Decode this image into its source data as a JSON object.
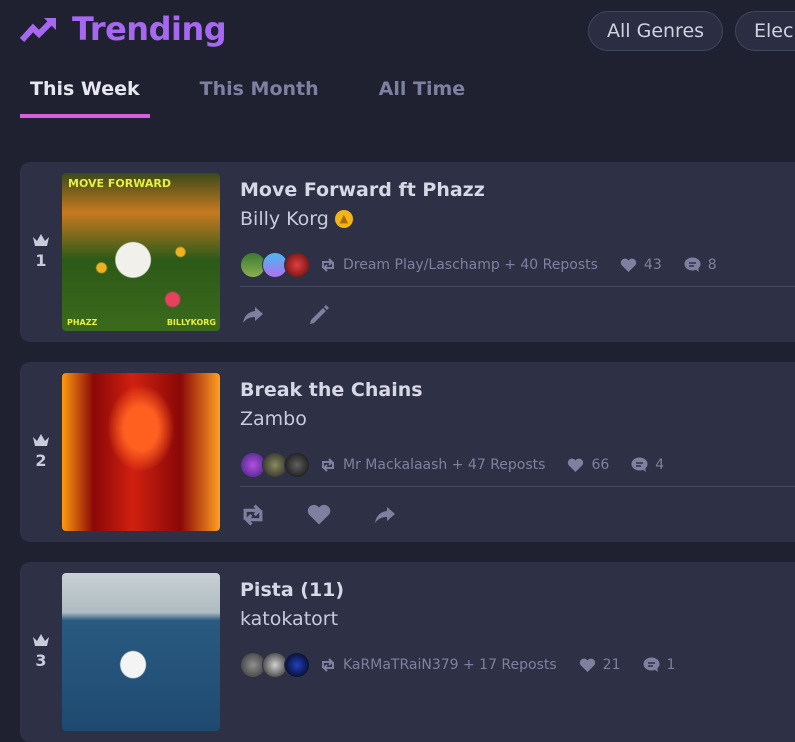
{
  "header": {
    "title": "Trending",
    "icon": "trending-up-icon"
  },
  "genres": [
    "All Genres",
    "Elec"
  ],
  "tabs": [
    {
      "label": "This Week",
      "active": true
    },
    {
      "label": "This Month"
    },
    {
      "label": "All Time"
    }
  ],
  "tracks": [
    {
      "rank": "1",
      "title": "Move Forward ft Phazz",
      "artist": "Billy Korg",
      "verified": true,
      "reposted_by": "Dream Play/Laschamp + 40 Reposts",
      "likes": "43",
      "comments": "8",
      "actions": [
        "share",
        "edit"
      ],
      "art_text_top": "MOVE FORWARD",
      "art_text_left": "PHAZZ",
      "art_text_right": "BILLYKORG"
    },
    {
      "rank": "2",
      "title": "Break the Chains",
      "artist": "Zambo",
      "reposted_by": "Mr Mackalaash + 47 Reposts",
      "likes": "66",
      "comments": "4",
      "actions": [
        "repost",
        "like",
        "share"
      ]
    },
    {
      "rank": "3",
      "title": "Pista (11)",
      "artist": "katokatort",
      "reposted_by": "KaRMaTRaiN379 + 17 Reposts",
      "likes": "21",
      "comments": "1"
    }
  ],
  "colors": {
    "accent": "#a668f0",
    "tab_underline": "#d65fe0",
    "card": "#2e3145",
    "bg": "#1f2130"
  }
}
